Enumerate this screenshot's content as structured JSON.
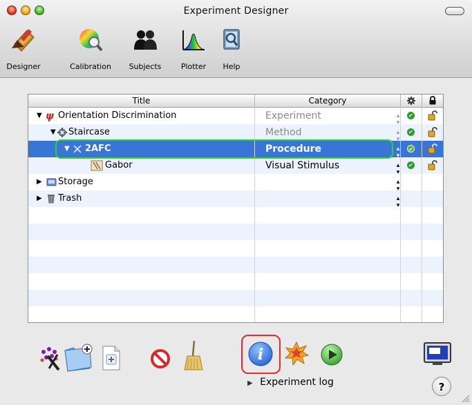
{
  "window": {
    "title": "Experiment Designer"
  },
  "toolbar": {
    "items": [
      {
        "label": "Designer",
        "icon": "pencil-ruler-icon"
      },
      {
        "label": "Calibration",
        "icon": "color-wheel-magnifier-icon"
      },
      {
        "label": "Subjects",
        "icon": "people-icon"
      },
      {
        "label": "Plotter",
        "icon": "spectrum-plot-icon"
      },
      {
        "label": "Help",
        "icon": "help-book-icon"
      }
    ]
  },
  "table": {
    "columns": {
      "title": "Title",
      "category": "Category",
      "enabled_icon": "gear-icon",
      "lock_icon": "lock-icon"
    },
    "rows": [
      {
        "title": "Orientation Discrimination",
        "category": "Experiment",
        "icon": "psi-icon",
        "level": 0,
        "expanded": true,
        "category_muted": true,
        "enabled": true,
        "locked": false
      },
      {
        "title": "Staircase",
        "category": "Method",
        "icon": "gear-icon",
        "level": 1,
        "expanded": true,
        "category_muted": true,
        "enabled": true,
        "locked": false
      },
      {
        "title": "2AFC",
        "category": "Procedure",
        "icon": "cross-icon",
        "level": 2,
        "expanded": true,
        "selected": true,
        "enabled": true,
        "locked": false
      },
      {
        "title": "Gabor",
        "category": "Visual Stimulus",
        "icon": "gabor-icon",
        "level": 3,
        "enabled": true,
        "locked": false
      },
      {
        "title": "Storage",
        "category": "",
        "icon": "drive-icon",
        "level": 0,
        "expanded": false
      },
      {
        "title": "Trash",
        "category": "",
        "icon": "trash-icon",
        "level": 0,
        "expanded": false
      }
    ]
  },
  "bottom": {
    "experiment_log_label": "Experiment log",
    "help_label": "?"
  },
  "colors": {
    "selection": "#3875d7",
    "highlight_ring": "#2fd42f",
    "info_ring": "#e12d2d"
  }
}
